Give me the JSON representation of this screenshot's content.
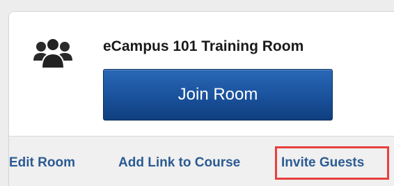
{
  "room": {
    "title": "eCampus 101 Training Room",
    "icon": "people-group-icon",
    "join_label": "Join Room"
  },
  "actions": {
    "edit_label": "Edit Room",
    "add_link_label": "Add Link to Course",
    "invite_label": "Invite Guests"
  },
  "colors": {
    "button_blue": "#1b539e",
    "link_blue": "#2b5b93",
    "highlight_red": "#e8403f"
  }
}
